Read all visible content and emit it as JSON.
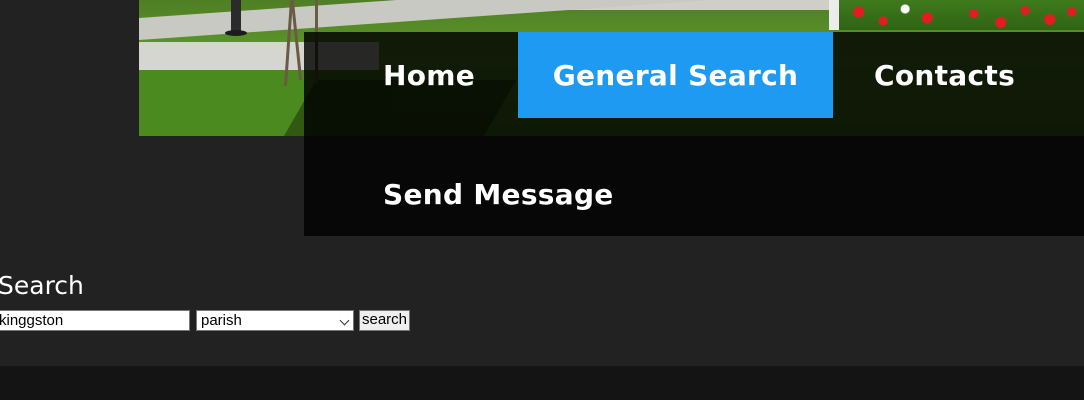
{
  "nav": {
    "items": [
      {
        "label": "Home"
      },
      {
        "label": "General Search"
      },
      {
        "label": "Contacts"
      },
      {
        "label": "Send Message"
      }
    ],
    "active_index": 1,
    "active_color": "#1e9af2"
  },
  "search": {
    "heading": "Search",
    "query_value": "kinggston",
    "filter_selected": "parish",
    "button_label": "search"
  },
  "colors": {
    "page_background": "#222222",
    "nav_background": "#000000",
    "footer_background": "#141414"
  },
  "icons": {
    "select_arrow": "chevron-down-icon"
  }
}
